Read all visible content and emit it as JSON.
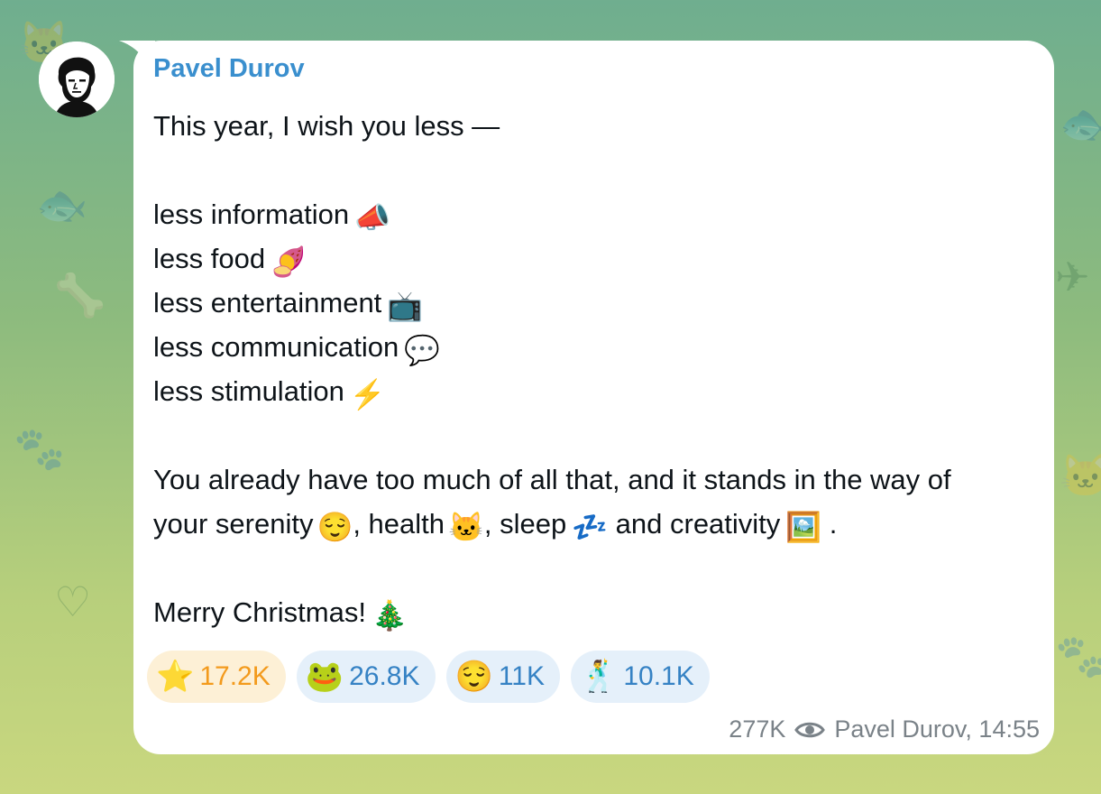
{
  "post": {
    "sender": "Pavel Durov",
    "avatar_icon": "person-portrait-icon",
    "lines": [
      {
        "text": "This year, I wish you less —",
        "emoji": ""
      },
      {
        "text": "",
        "emoji": ""
      },
      {
        "text": "less information",
        "emoji": "📣"
      },
      {
        "text": "less food",
        "emoji": "🍠"
      },
      {
        "text": "less entertainment",
        "emoji": "📺"
      },
      {
        "text": "less communication",
        "emoji": "💬"
      },
      {
        "text": "less stimulation",
        "emoji": "⚡"
      },
      {
        "text": "",
        "emoji": ""
      },
      {
        "text": "You already have too much of all that, and it stands in the way of",
        "emoji": ""
      },
      {
        "text": "your serenity",
        "emoji": "🫠"
      },
      {
        "text": "",
        "emoji": ""
      },
      {
        "text": "Merry Christmas!",
        "emoji": "🎄"
      }
    ],
    "serenity_line": {
      "part1": "your serenity",
      "emoji1": "😌",
      "part2": ", health",
      "emoji2": "🐱",
      "part3": ", sleep",
      "emoji3": "💤",
      "part4": " and creativity",
      "emoji4": "🖼️",
      "part5": " ."
    },
    "reactions": [
      {
        "icon": "⭐",
        "icon_name": "star-icon",
        "count": "17.2K",
        "kind": "star"
      },
      {
        "icon": "🐸",
        "icon_name": "frog-icon",
        "count": "26.8K",
        "kind": "normal"
      },
      {
        "icon": "😌",
        "icon_name": "relieved-face-icon",
        "count": "11K",
        "kind": "normal"
      },
      {
        "icon": "🕺",
        "icon_name": "dancing-man-icon",
        "count": "10.1K",
        "kind": "normal"
      }
    ],
    "views": "277K",
    "footer_author": "Pavel Durov, 14:55"
  },
  "colors": {
    "sender": "#3a8fce",
    "star_bg": "#fdf0d6",
    "star_text": "#f39a1c",
    "reaction_bg": "#e5f0fa",
    "reaction_text": "#3582c4"
  }
}
